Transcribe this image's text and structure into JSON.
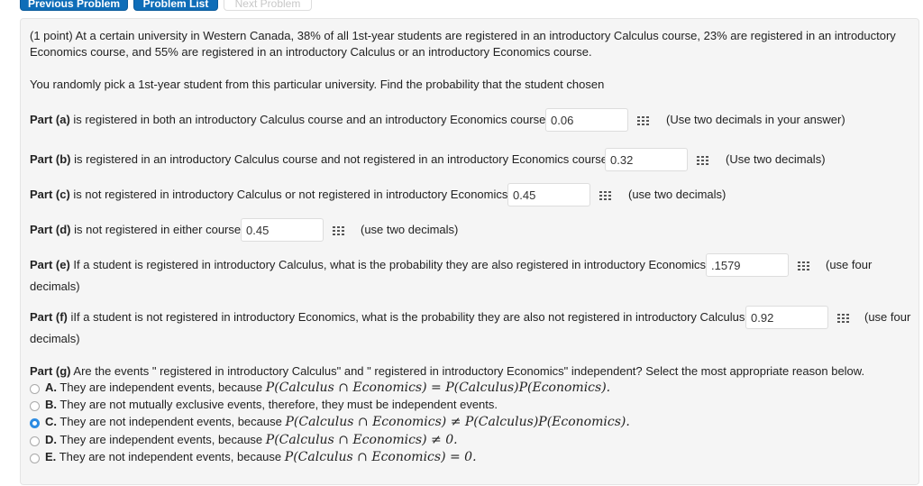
{
  "nav": {
    "prev": "Previous Problem",
    "list": "Problem List",
    "next": "Next Problem"
  },
  "intro": {
    "line1": "(1 point) At a certain university in Western Canada, 38% of all 1st-year students are registered in an introductory Calculus course, 23% are registered in an introductory",
    "line2": "Economics course, and 55% are registered in an introductory Calculus or an introductory Economics course.",
    "line3": "You randomly pick a 1st-year student from this particular university. Find the probability that the student chosen"
  },
  "parts": [
    {
      "label": "Part (a)",
      "text": "is registered in both an introductory Calculus course and an introductory Economics course.",
      "answer": "0.06",
      "hint": "(Use two decimals in your answer)"
    },
    {
      "label": "Part (b)",
      "text": "is registered in an introductory Calculus course and not registered in an introductory Economics course.",
      "answer": "0.32",
      "hint": "(Use two decimals)"
    },
    {
      "label": "Part (c)",
      "text": "is not registered in introductory Calculus or not registered in introductory Economics.",
      "answer": "0.45",
      "hint": "(use two decimals)"
    },
    {
      "label": "Part (d)",
      "text": "is not registered in either course",
      "answer": "0.45",
      "hint": "(use two decimals)"
    },
    {
      "label": "Part (e)",
      "text": "If a student is registered in introductory Calculus, what is the probability they are also registered in introductory Economics?",
      "answer": ".1579",
      "hint": "(use four",
      "hint2": "decimals)"
    },
    {
      "label": "Part (f)",
      "text": "iIf a student is not registered in introductory Economics, what is the probability they are also not registered in introductory Calculus?",
      "answer": "0.92",
      "hint": "(use four",
      "hint2": "decimals)"
    }
  ],
  "partg": {
    "label": "Part (g)",
    "text": "Are the events \" registered in introductory Calculus\" and \" registered in introductory Economics\" independent? Select the most appropriate reason below.",
    "options": [
      {
        "letter": "A.",
        "text": "They are independent events, because",
        "math": "P(Calculus ∩ Economics) = P(Calculus)P(Economics).",
        "selected": false
      },
      {
        "letter": "B.",
        "text": "They are not mutually exclusive events, therefore, they must be independent events.",
        "math": "",
        "selected": false
      },
      {
        "letter": "C.",
        "text": "They are not independent events, because",
        "math": "P(Calculus ∩ Economics) ≠ P(Calculus)P(Economics).",
        "selected": true
      },
      {
        "letter": "D.",
        "text": "They are independent events, because",
        "math": "P(Calculus ∩ Economics) ≠ 0.",
        "selected": false
      },
      {
        "letter": "E.",
        "text": "They are not independent events, because",
        "math": "P(Calculus ∩ Economics) = 0.",
        "selected": false
      }
    ]
  },
  "colors": {
    "accent": "#2c8be2",
    "button": "#0e6db8",
    "panel": "#f5f5f5"
  }
}
